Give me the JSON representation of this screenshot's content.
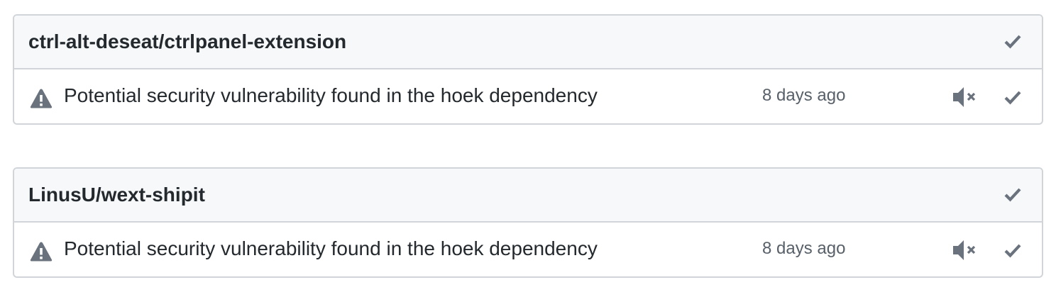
{
  "groups": [
    {
      "repo": "ctrl-alt-deseat/ctrlpanel-extension",
      "notifications": [
        {
          "title": "Potential security vulnerability found in the hoek dependency",
          "time": "8 days ago",
          "type_icon": "alert-icon"
        }
      ]
    },
    {
      "repo": "LinusU/wext-shipit",
      "notifications": [
        {
          "title": "Potential security vulnerability found in the hoek dependency",
          "time": "8 days ago",
          "type_icon": "alert-icon"
        }
      ]
    }
  ],
  "icons": {
    "mark_read": "check-icon",
    "mute": "mute-icon"
  },
  "colors": {
    "text": "#24292e",
    "muted": "#586069",
    "icon": "#6a737d",
    "border": "#d1d5da",
    "header_bg": "#f6f8fa"
  }
}
